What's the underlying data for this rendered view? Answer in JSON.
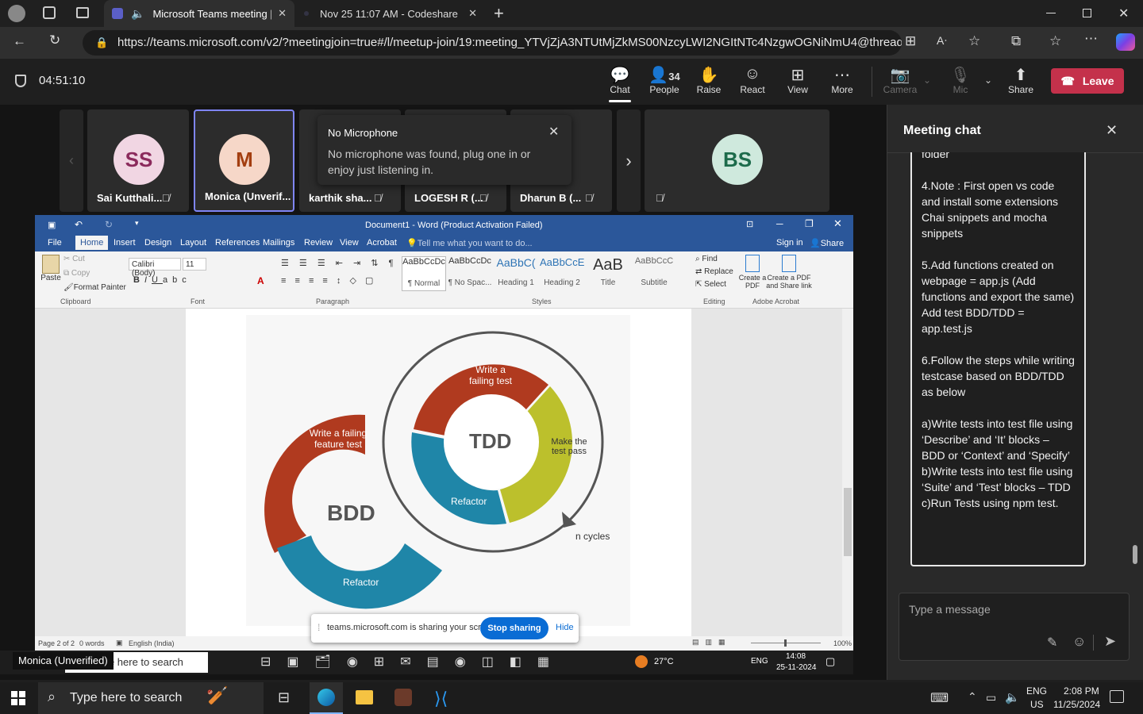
{
  "browser": {
    "tabs": [
      {
        "title": "Microsoft Teams meeting | M",
        "active": true
      },
      {
        "title": "Nov 25 11:07 AM - Codeshare",
        "active": false
      }
    ],
    "url": "https://teams.microsoft.com/v2/?meetingjoin=true#/l/meetup-join/19:meeting_YTVjZjA3NTUtMjZkMS00NzcyLWI2NGItNTc4NzgwOGNiNmU4@thread.v2/0?..."
  },
  "meeting": {
    "timer": "04:51:10",
    "toolbar": {
      "chat": "Chat",
      "people": "People",
      "people_count": "34",
      "raise": "Raise",
      "react": "React",
      "view": "View",
      "more": "More",
      "camera": "Camera",
      "mic": "Mic",
      "share": "Share",
      "leave": "Leave"
    },
    "participants": [
      {
        "initials": "SS",
        "name": "Sai Kutthali...",
        "color": "#f1d6e3",
        "text": "#8b2a5c"
      },
      {
        "initials": "M",
        "name": "Monica (Unverif...",
        "color": "#f6d7c8",
        "text": "#a33e10"
      },
      {
        "initials": "",
        "name": "karthik sha..."
      },
      {
        "initials": "",
        "name": "LOGESH R (..."
      },
      {
        "initials": "",
        "name": "Dharun B (..."
      },
      {
        "initials": "BS",
        "name": "",
        "color": "#cfe9dd",
        "text": "#1d6b4b"
      }
    ],
    "toast": {
      "title": "No Microphone",
      "body": "No microphone was found, plug one in or enjoy just listening in."
    },
    "presenter_label": "Monica (Unverified)",
    "share_notice": {
      "text": "teams.microsoft.com is sharing your screen.",
      "stop": "Stop sharing",
      "hide": "Hide"
    }
  },
  "word": {
    "title": "Document1 - Word (Product Activation Failed)",
    "tabs": [
      "File",
      "Home",
      "Insert",
      "Design",
      "Layout",
      "References",
      "Mailings",
      "Review",
      "View",
      "Acrobat"
    ],
    "tell_me": "Tell me what you want to do...",
    "sign_in": "Sign in",
    "share": "Share",
    "clipboard": {
      "paste": "Paste",
      "cut": "Cut",
      "copy": "Copy",
      "format_painter": "Format Painter",
      "label": "Clipboard"
    },
    "font": {
      "name": "Calibri (Body)",
      "size": "11",
      "label": "Font"
    },
    "paragraph_label": "Paragraph",
    "styles": [
      {
        "preview": "AaBbCcDc",
        "name": "¶ Normal"
      },
      {
        "preview": "AaBbCcDc",
        "name": "¶ No Spac..."
      },
      {
        "preview": "AaBbC(",
        "name": "Heading 1"
      },
      {
        "preview": "AaBbCcE",
        "name": "Heading 2"
      },
      {
        "preview": "AaB",
        "name": "Title"
      },
      {
        "preview": "AaBbCcC",
        "name": "Subtitle"
      }
    ],
    "styles_label": "Styles",
    "editing": {
      "find": "Find",
      "replace": "Replace",
      "select": "Select",
      "label": "Editing"
    },
    "acrobat": {
      "create_pdf": "Create a PDF",
      "create_share": "Create a PDF and Share link",
      "label": "Adobe Acrobat"
    },
    "status": {
      "page": "Page 2 of 2",
      "words": "0 words",
      "lang": "English (India)",
      "zoom": "100%"
    },
    "diagram": {
      "bdd": "BDD",
      "tdd": "TDD",
      "write_failing_feature": "Write a failing feature test",
      "bdd_refactor": "Refactor",
      "write_failing": "Write a failing test",
      "make_pass": "Make the test pass",
      "tdd_refactor": "Refactor",
      "cycles": "n cycles"
    }
  },
  "inner_taskbar": {
    "search": "Type here to search",
    "weather": "27°C",
    "lang": "ENG",
    "time": "14:08",
    "date": "25-11-2024"
  },
  "chat": {
    "title": "Meeting chat",
    "cut_top": "folder",
    "messages": [
      "4.Note : First open vs code and install some extensions\nChai snippets and mocha snippets",
      "5.Add functions created on webpage = app.js (Add functions and export the same)\nAdd test BDD/TDD = app.test.js",
      "6.Follow the steps while writing testcase based on BDD/TDD as below",
      "a)Write tests into test file using ‘Describe’ and ‘It’ blocks – BDD or ‘Context’ and ‘Specify’\nb)Write tests into test file using ‘Suite’ and ‘Test’ blocks – TDD\nc)Run Tests using npm test."
    ],
    "placeholder": "Type a message"
  },
  "taskbar": {
    "search": "Type here to search",
    "lang": "ENG",
    "region": "US",
    "time": "2:08 PM",
    "date": "11/25/2024"
  }
}
